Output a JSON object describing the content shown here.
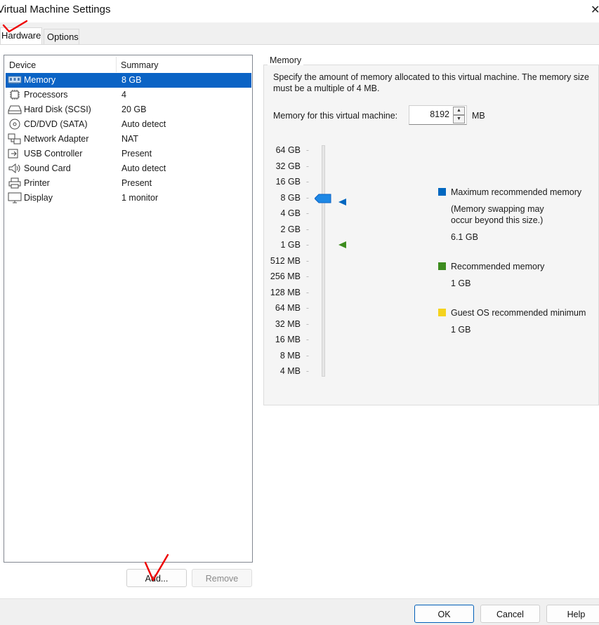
{
  "window": {
    "title": "Virtual Machine Settings",
    "close_glyph": "✕"
  },
  "tabs": [
    {
      "label": "Hardware"
    },
    {
      "label": "Options"
    }
  ],
  "device_list": {
    "col_device": "Device",
    "col_summary": "Summary",
    "rows": [
      {
        "name": "Memory",
        "summary": "8 GB",
        "icon": "memory-icon",
        "selected": true
      },
      {
        "name": "Processors",
        "summary": "4",
        "icon": "processor-icon"
      },
      {
        "name": "Hard Disk (SCSI)",
        "summary": "20 GB",
        "icon": "hard-disk-icon"
      },
      {
        "name": "CD/DVD (SATA)",
        "summary": "Auto detect",
        "icon": "cd-dvd-icon"
      },
      {
        "name": "Network Adapter",
        "summary": "NAT",
        "icon": "network-adapter-icon"
      },
      {
        "name": "USB Controller",
        "summary": "Present",
        "icon": "usb-icon"
      },
      {
        "name": "Sound Card",
        "summary": "Auto detect",
        "icon": "speaker-icon"
      },
      {
        "name": "Printer",
        "summary": "Present",
        "icon": "printer-icon"
      },
      {
        "name": "Display",
        "summary": "1 monitor",
        "icon": "monitor-icon"
      }
    ],
    "add_label": "Add...",
    "remove_label": "Remove"
  },
  "memory": {
    "group_title": "Memory",
    "description": "Specify the amount of memory allocated to this virtual machine. The memory size must be a multiple of 4 MB.",
    "field_label": "Memory for this virtual machine:",
    "value": "8192",
    "unit": "MB",
    "scale": [
      "64 GB",
      "32 GB",
      "16 GB",
      "8 GB",
      "4 GB",
      "2 GB",
      "1 GB",
      "512 MB",
      "256 MB",
      "128 MB",
      "64 MB",
      "32 MB",
      "16 MB",
      "8 MB",
      "4 MB"
    ],
    "slider_value": "8 GB",
    "max_marker_value": "8 GB",
    "rec_marker_value": "1 GB",
    "legend": {
      "max_title": "Maximum recommended memory",
      "max_note_line1": "(Memory swapping may",
      "max_note_line2": "occur beyond this size.)",
      "max_value": "6.1 GB",
      "rec_title": "Recommended memory",
      "rec_value": "1 GB",
      "min_title": "Guest OS recommended minimum",
      "min_value": "1 GB"
    },
    "colors": {
      "max": "#0067c0",
      "recommended": "#3c8c1e",
      "minimum": "#f5d31e",
      "selection": "#0a63c5",
      "thumb": "#1e88e5"
    }
  },
  "footer": {
    "ok_label": "OK",
    "cancel_label": "Cancel",
    "help_label": "Help"
  }
}
